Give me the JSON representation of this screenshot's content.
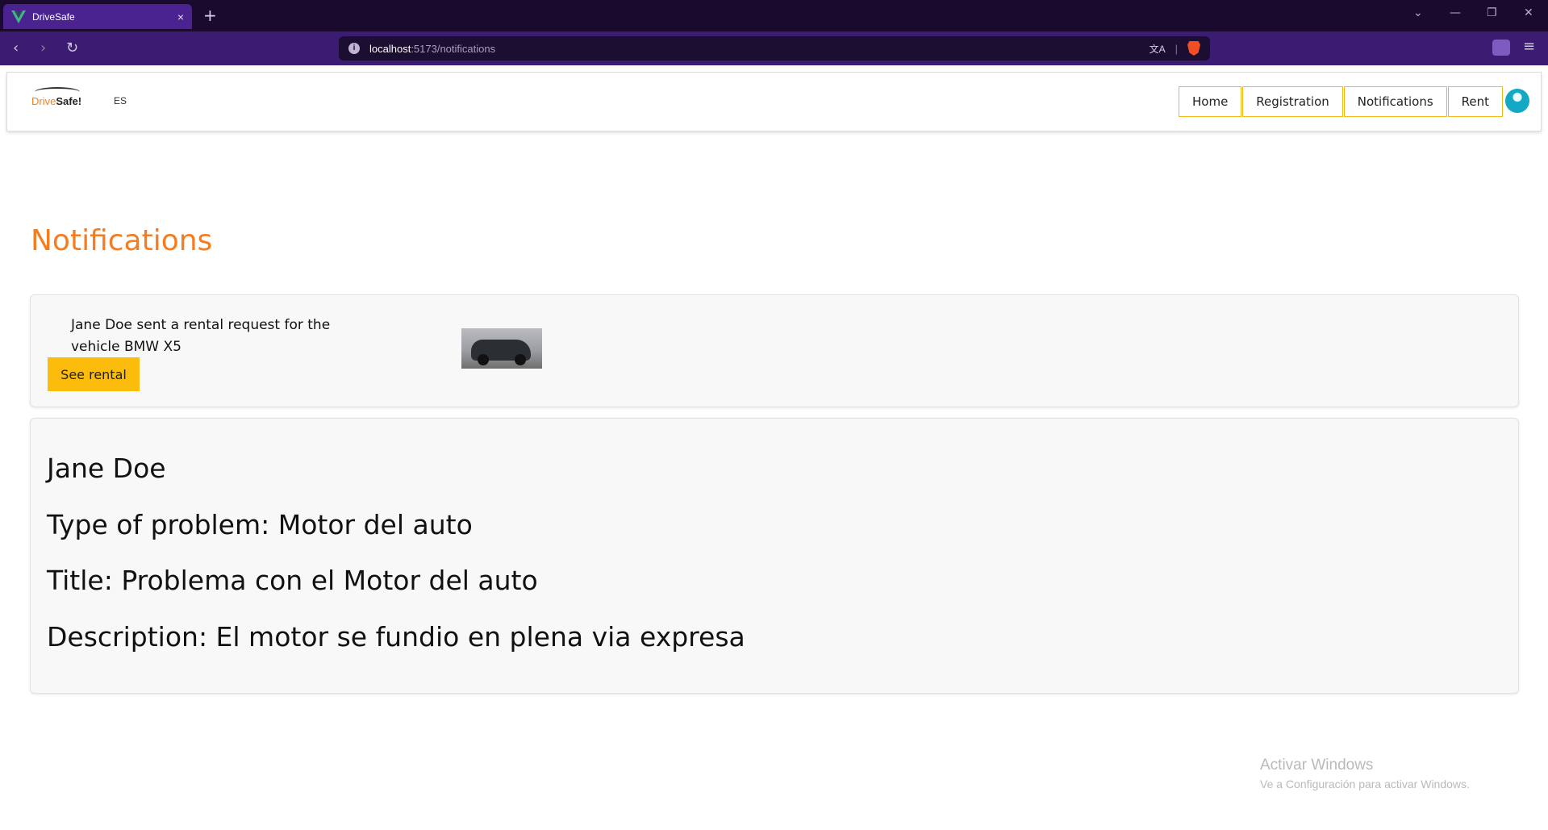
{
  "browser": {
    "tab_title": "DriveSafe",
    "tab_close": "×",
    "new_tab": "+",
    "url_host": "localhost",
    "url_path": ":5173/notifications",
    "minimize": "—",
    "restore": "❐",
    "close": "✕",
    "dropdown": "⌄",
    "back": "‹",
    "forward": "›",
    "reload": "↻",
    "menu": "≡",
    "translate": "文A",
    "info": "i"
  },
  "header": {
    "logo_part1": "Drive",
    "logo_part2": "Safe!",
    "language": "ES",
    "nav": [
      {
        "label": "Home"
      },
      {
        "label": "Registration"
      },
      {
        "label": "Notifications"
      },
      {
        "label": "Rent"
      }
    ]
  },
  "main": {
    "title": "Notifications",
    "rental_notification": {
      "message": "Jane Doe sent a rental request for the vehicle BMW X5",
      "button_label": "See rental",
      "thumbnail_icon": "car-thumbnail"
    },
    "problem_report": {
      "name": "Jane Doe",
      "type_of_problem": "Type of problem: Motor del auto",
      "title": "Title: Problema con el Motor del auto",
      "description": "Description: El motor se fundio en plena via expresa"
    }
  },
  "os_watermark": {
    "title": "Activar Windows",
    "subtitle": "Ve a Configuración para activar Windows."
  },
  "colors": {
    "accent_orange": "#f57c1f",
    "button_yellow": "#fbbc0c",
    "nav_border": "#f3b71a",
    "browser_purple": "#3c1c72"
  }
}
